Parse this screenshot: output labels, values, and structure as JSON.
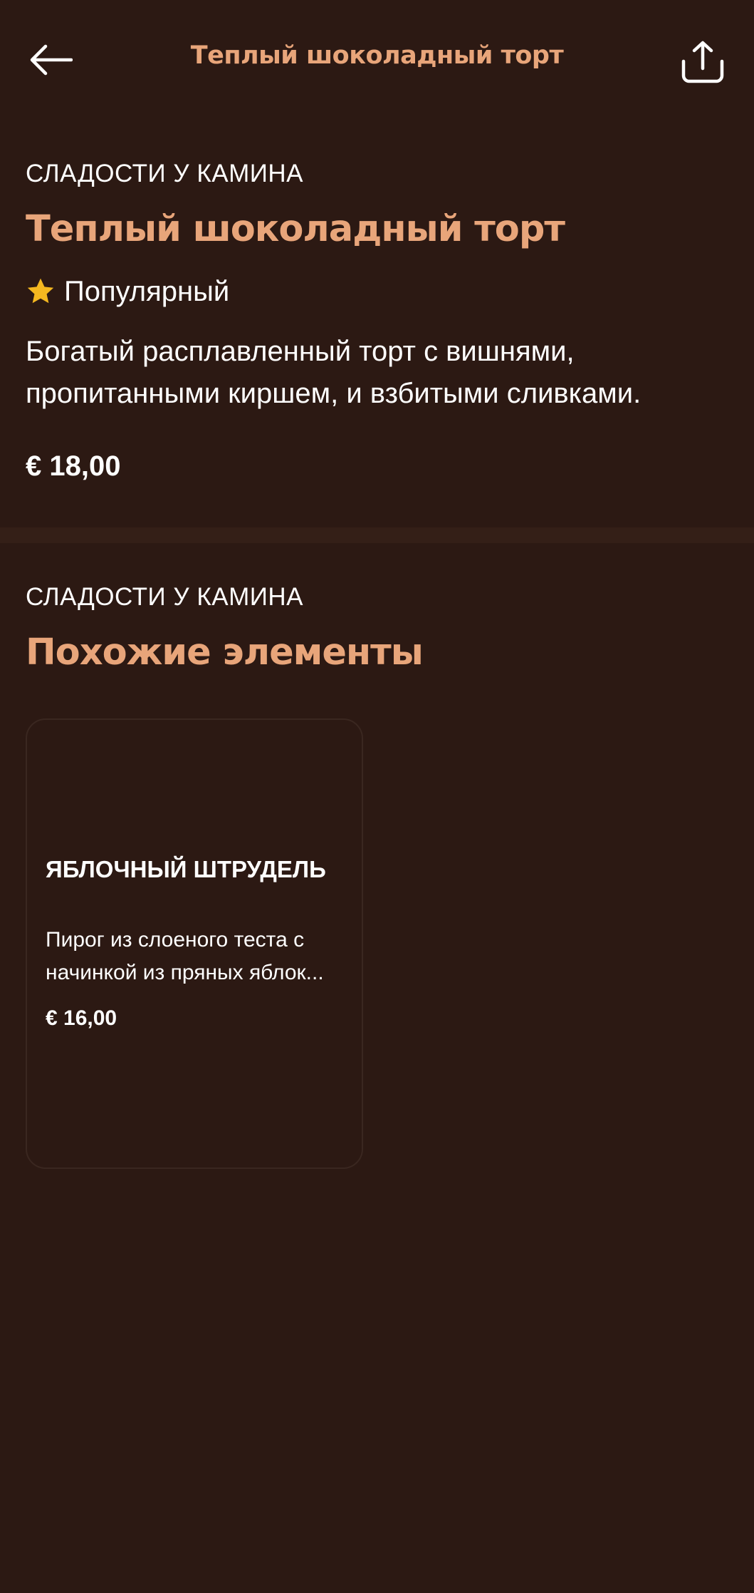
{
  "header": {
    "title": "Теплый шоколадный торт",
    "back_icon": "arrow-left-icon",
    "share_icon": "share-icon"
  },
  "item": {
    "category": "СЛАДОСТИ У КАМИНА",
    "name": "Теплый шоколадный торт",
    "badge_icon": "star-icon",
    "badge_label": "Популярный",
    "description": "Богатый расплавленный торт с вишнями, пропитанными киршем, и взбитыми сливками.",
    "price": "€ 18,00"
  },
  "related": {
    "category": "СЛАДОСТИ У КАМИНА",
    "title": "Похожие элементы",
    "items": [
      {
        "name": "ЯБЛОЧНЫЙ ШТРУДЕЛЬ",
        "description": "Пирог из слоеного теста с начинкой из пряных яблок...",
        "price": "€ 16,00"
      }
    ]
  },
  "colors": {
    "background": "#2c1913",
    "accent": "#e8a57a",
    "divider": "#341f17",
    "star": "#f5b820",
    "text": "#ffffff"
  }
}
